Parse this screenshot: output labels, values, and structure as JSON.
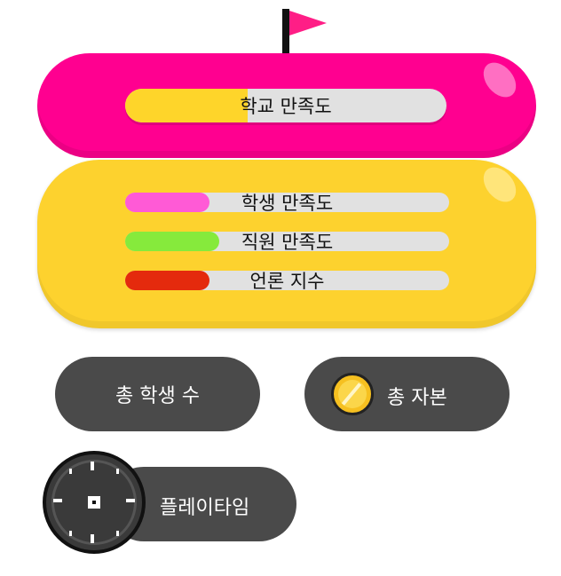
{
  "school": {
    "label": "학교 만족도",
    "level": 0.38,
    "color": "#fed52a"
  },
  "stats": [
    {
      "label": "학생 만족도",
      "level": 0.26,
      "color": "#ff5ad6"
    },
    {
      "label": "직원 만족도",
      "level": 0.29,
      "color": "#86ea3c"
    },
    {
      "label": "언론 지수",
      "level": 0.26,
      "color": "#e42a0d"
    }
  ],
  "counters": {
    "students_label": "총 학생 수",
    "capital_label": "총 자본",
    "playtime_label": "플레이타임"
  },
  "icons": {
    "flag": "flag-icon",
    "coin": "coin-icon",
    "clock": "clock-icon"
  },
  "colors": {
    "pink_panel": "#ff0090",
    "yellow_panel": "#fdd22e",
    "dark_pill": "#4a4a4a"
  }
}
